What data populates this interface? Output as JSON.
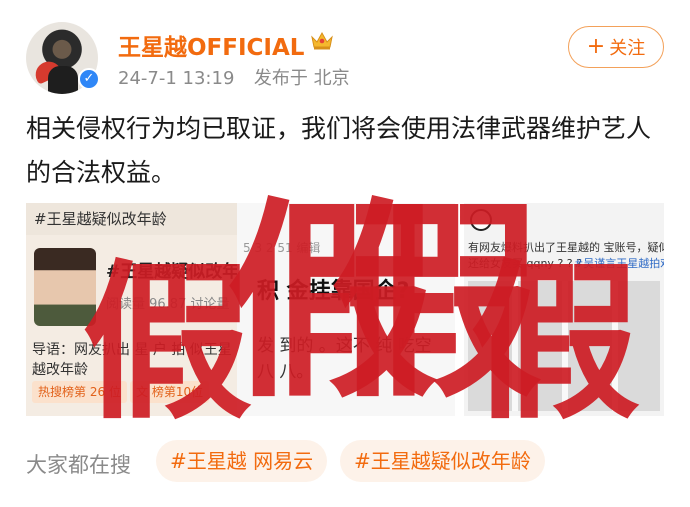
{
  "post": {
    "username": "王星越OFFICIAL",
    "timestamp": "24-7-1 13:19",
    "location": "发布于 北京",
    "follow_label": "关注",
    "content": "相关侵权行为均已取证，我们将会使用法律武器维护艺人的合法权益。"
  },
  "images": {
    "img1": {
      "topic_bar": "#王星越疑似改年龄",
      "topic": "#王星越疑似改年龄",
      "stats": "阅读量 96.87 讨论量",
      "lead": "导语：网友扒出 星 户 拍 似王星越改年龄",
      "rank_a": "热搜榜第 26 位",
      "rank_b": "文 榜第10位"
    },
    "img2": {
      "header": "5 3 2 51 编辑",
      "headline": "积 金挂靠国企?",
      "body_line1": "发 到的 。这不 纯 吃空",
      "body_line2": "八 八。"
    },
    "img3": {
      "line1": "有网友爆料扒出了王星越的 宝账号，疑似",
      "line2": "还给女友买 qqny ? ? ?",
      "hashtag": "#吴谨言王星越拍戏"
    }
  },
  "overlay": {
    "mark1": "假",
    "mark2": "假",
    "mark3": "假",
    "mark4": "假"
  },
  "trending": {
    "label": "大家都在搜",
    "tags": [
      "#王星越 网易云",
      "#王星越疑似改年龄"
    ]
  },
  "colors": {
    "accent": "#f26b0f",
    "overlay_red": "#cd1c24",
    "verified_blue": "#2f87f7"
  },
  "icons": {
    "crown": "crown-icon",
    "verified": "verified-badge-icon",
    "follow": "plus-icon"
  }
}
